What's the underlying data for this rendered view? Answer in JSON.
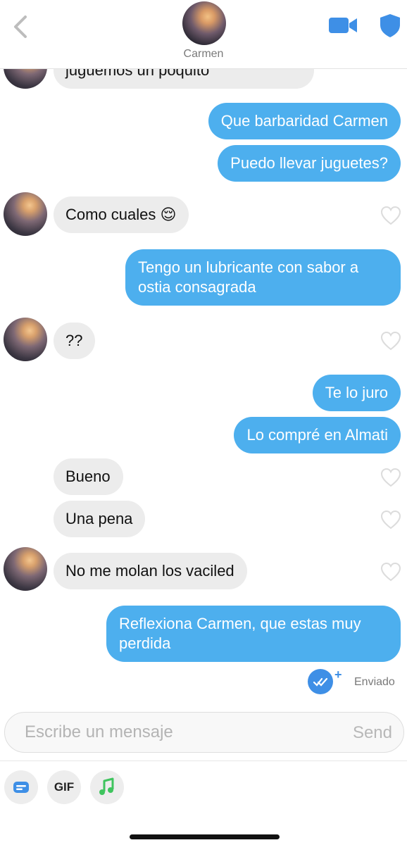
{
  "header": {
    "contact_name": "Carmen",
    "back_icon": "chevron-left-icon",
    "video_icon": "video-camera-icon",
    "safety_icon": "shield-icon",
    "accent_color": "#3e8fe6"
  },
  "messages": [
    {
      "sender": "them",
      "text": "juguemos un poquito"
    },
    {
      "sender": "me",
      "text": "Que barbaridad Carmen"
    },
    {
      "sender": "me",
      "text": "Puedo llevar juguetes?"
    },
    {
      "sender": "them",
      "text": "Como cuales 😌"
    },
    {
      "sender": "me",
      "text": "Tengo un lubricante con sabor a ostia consagrada"
    },
    {
      "sender": "them",
      "text": "??"
    },
    {
      "sender": "me",
      "text": "Te lo juro"
    },
    {
      "sender": "me",
      "text": "Lo compré en Almati"
    },
    {
      "sender": "them",
      "text": "Bueno"
    },
    {
      "sender": "them",
      "text": "Una pena"
    },
    {
      "sender": "them",
      "text": "No me molan los vaciled"
    },
    {
      "sender": "me",
      "text": "Reflexiona Carmen, que estas muy perdida"
    }
  ],
  "status": {
    "label": "Enviado",
    "icon": "double-check-icon"
  },
  "composer": {
    "placeholder": "Escribe un mensaje",
    "send_label": "Send"
  },
  "toolbar": {
    "gif_label": "GIF",
    "sticker_icon": "sticker-icon",
    "music_icon": "music-note-icon"
  },
  "colors": {
    "outgoing_bubble": "#4dafee",
    "incoming_bubble": "#ececec",
    "music_green": "#3fc45e"
  }
}
